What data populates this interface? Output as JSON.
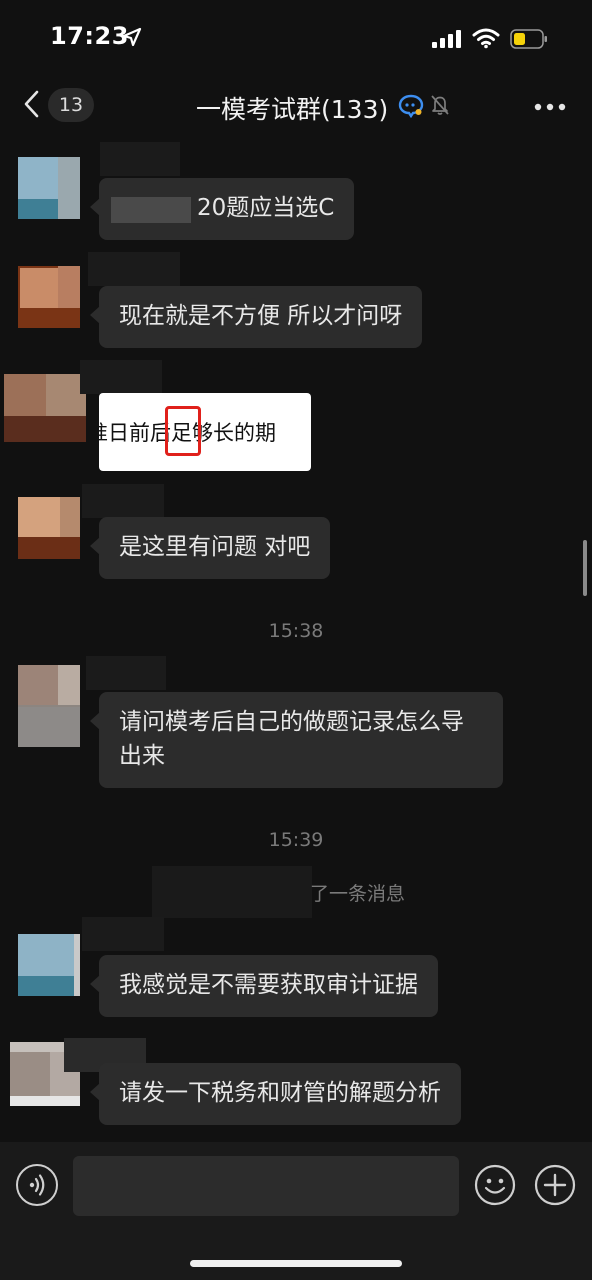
{
  "status_bar": {
    "time": "17:23"
  },
  "header": {
    "back_count": "13",
    "title": "一模考试群(133)"
  },
  "messages": [
    {
      "text": "20题应当选C"
    },
    {
      "text": "现在就是不方便 所以才问呀"
    },
    {
      "image_text": "准日前后足够长的期",
      "highlight": "后"
    },
    {
      "text": "是这里有问题 对吧"
    },
    {
      "text": "请问模考后自己的做题记录怎么导出来"
    },
    {
      "text": "我感觉是不需要获取审计证据"
    },
    {
      "text": "请发一下税务和财管的解题分析"
    }
  ],
  "timestamps": [
    "15:38",
    "15:39"
  ],
  "system_message": "了一条消息",
  "colors": {
    "background": "#111111",
    "bubble": "#2c2c2c",
    "highlight_box": "#e0201b"
  }
}
